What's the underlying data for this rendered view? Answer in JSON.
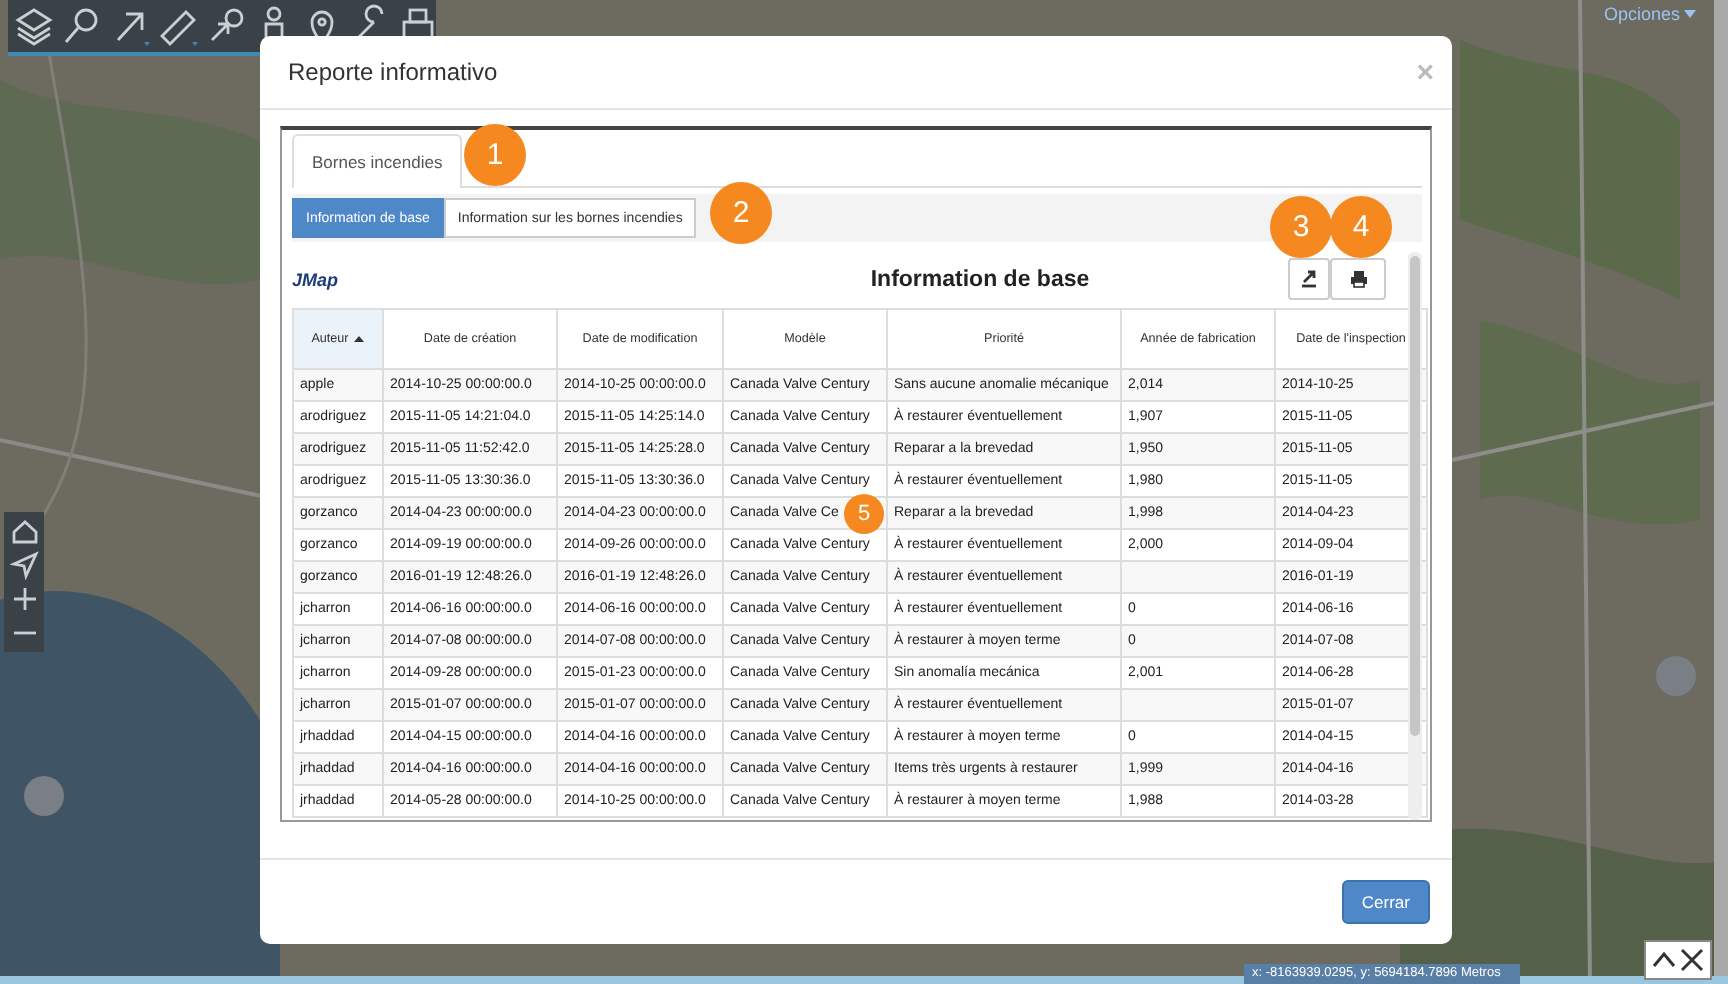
{
  "map": {
    "options_link": "Opciones",
    "coordinates": "x: -8163939.0295, y: 5694184.7896 Metros"
  },
  "dialog": {
    "title": "Reporte informativo",
    "close": "×",
    "tabs": [
      {
        "label": "Bornes incendies",
        "selected": true
      }
    ],
    "subtabs": [
      {
        "label": "Information de base",
        "selected": true
      },
      {
        "label": "Information sur les bornes incendies",
        "selected": false
      }
    ],
    "report": {
      "logo": "JMap",
      "title": "Information de base",
      "columns": [
        {
          "label": "Auteur",
          "sorted": true
        },
        {
          "label": "Date de création",
          "sorted": false
        },
        {
          "label": "Date de modification",
          "sorted": false
        },
        {
          "label": "Modèle",
          "sorted": false
        },
        {
          "label": "Priorité",
          "sorted": false
        },
        {
          "label": "Année de fabrication",
          "sorted": false
        },
        {
          "label": "Date de l'inspection",
          "sorted": false
        }
      ],
      "rows": [
        [
          "apple",
          "2014-10-25 00:00:00.0",
          "2014-10-25 00:00:00.0",
          "Canada Valve Century",
          "Sans aucune anomalie mécanique",
          "2,014",
          "2014-10-25"
        ],
        [
          "arodriguez",
          "2015-11-05 14:21:04.0",
          "2015-11-05 14:25:14.0",
          "Canada Valve Century",
          "À restaurer éventuellement",
          "1,907",
          "2015-11-05"
        ],
        [
          "arodriguez",
          "2015-11-05 11:52:42.0",
          "2015-11-05 14:25:28.0",
          "Canada Valve Century",
          "Reparar a la brevedad",
          "1,950",
          "2015-11-05"
        ],
        [
          "arodriguez",
          "2015-11-05 13:30:36.0",
          "2015-11-05 13:30:36.0",
          "Canada Valve Century",
          "À restaurer éventuellement",
          "1,980",
          "2015-11-05"
        ],
        [
          "gorzanco",
          "2014-04-23 00:00:00.0",
          "2014-04-23 00:00:00.0",
          "Canada Valve Ce",
          "Reparar a la brevedad",
          "1,998",
          "2014-04-23"
        ],
        [
          "gorzanco",
          "2014-09-19 00:00:00.0",
          "2014-09-26 00:00:00.0",
          "Canada Valve Century",
          "À restaurer éventuellement",
          "2,000",
          "2014-09-04"
        ],
        [
          "gorzanco",
          "2016-01-19 12:48:26.0",
          "2016-01-19 12:48:26.0",
          "Canada Valve Century",
          "À restaurer éventuellement",
          "",
          "2016-01-19"
        ],
        [
          "jcharron",
          "2014-06-16 00:00:00.0",
          "2014-06-16 00:00:00.0",
          "Canada Valve Century",
          "À restaurer éventuellement",
          "0",
          "2014-06-16"
        ],
        [
          "jcharron",
          "2014-07-08 00:00:00.0",
          "2014-07-08 00:00:00.0",
          "Canada Valve Century",
          "À restaurer à moyen terme",
          "0",
          "2014-07-08"
        ],
        [
          "jcharron",
          "2014-09-28 00:00:00.0",
          "2015-01-23 00:00:00.0",
          "Canada Valve Century",
          "Sin anomalía mecánica",
          "2,001",
          "2014-06-28"
        ],
        [
          "jcharron",
          "2015-01-07 00:00:00.0",
          "2015-01-07 00:00:00.0",
          "Canada Valve Century",
          "À restaurer éventuellement",
          "",
          "2015-01-07"
        ],
        [
          "jrhaddad",
          "2014-04-15 00:00:00.0",
          "2014-04-16 00:00:00.0",
          "Canada Valve Century",
          "À restaurer à moyen terme",
          "0",
          "2014-04-15"
        ],
        [
          "jrhaddad",
          "2014-04-16 00:00:00.0",
          "2014-04-16 00:00:00.0",
          "Canada Valve Century",
          "Items très urgents à restaurer",
          "1,999",
          "2014-04-16"
        ],
        [
          "jrhaddad",
          "2014-05-28 00:00:00.0",
          "2014-10-25 00:00:00.0",
          "Canada Valve Century",
          "À restaurer à moyen terme",
          "1,988",
          "2014-03-28"
        ]
      ]
    },
    "callouts": [
      "1",
      "2",
      "3",
      "4",
      "5"
    ],
    "buttons": [
      "Cerrar"
    ]
  }
}
